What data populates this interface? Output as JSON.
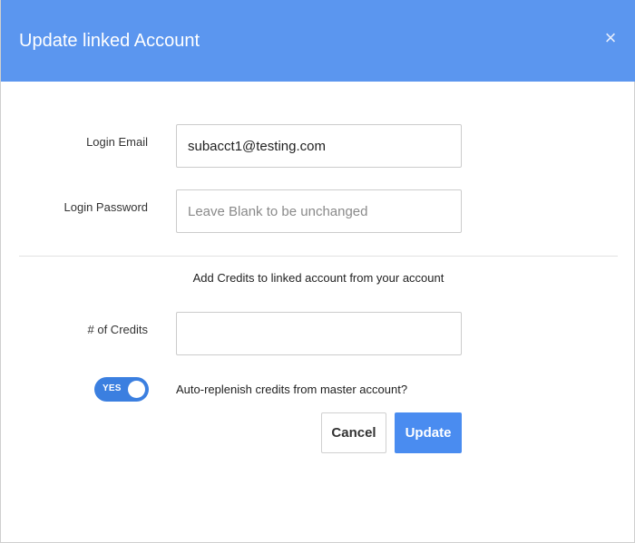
{
  "dialog": {
    "title": "Update linked Account",
    "close_glyph": "×"
  },
  "form": {
    "email": {
      "label": "Login Email",
      "value": "subacct1@testing.com",
      "placeholder": ""
    },
    "password": {
      "label": "Login Password",
      "value": "",
      "placeholder": "Leave Blank to be unchanged"
    },
    "section_note": "Add Credits to linked account from your account",
    "credits": {
      "label": "# of Credits",
      "value": "",
      "placeholder": ""
    },
    "auto_replenish": {
      "toggle_text": "YES",
      "enabled": true,
      "label": "Auto-replenish credits from master account?"
    }
  },
  "actions": {
    "cancel_label": "Cancel",
    "update_label": "Update"
  },
  "colors": {
    "header": "#5b96ef",
    "primary": "#4a8cf0",
    "toggle_on": "#3b7fe0"
  },
  "icons": {
    "close": "close-icon"
  }
}
